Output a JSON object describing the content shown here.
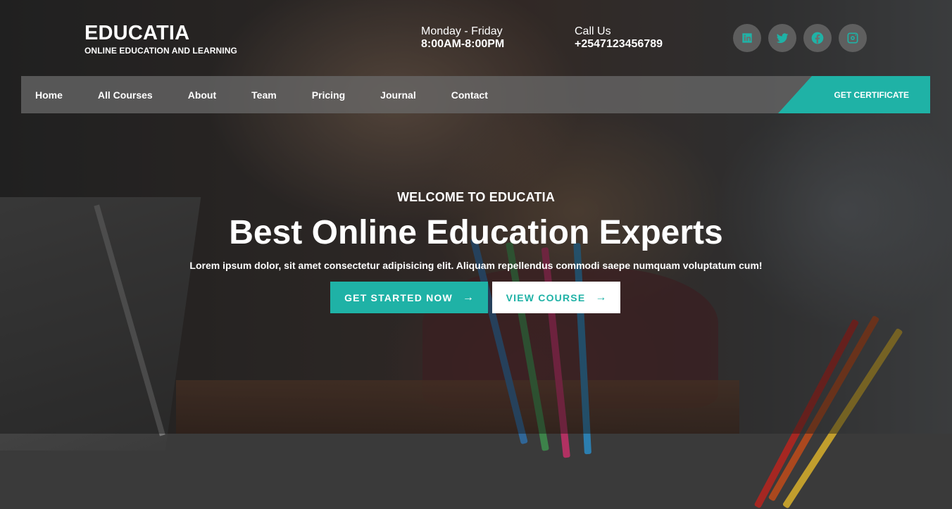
{
  "brand": {
    "name": "EDUCATIA",
    "tagline": "ONLINE EDUCATION AND LEARNING"
  },
  "contact": {
    "hours_label": "Monday - Friday",
    "hours_value": "8:00AM-8:00PM",
    "phone_label": "Call Us",
    "phone_value": "+2547123456789"
  },
  "socials": [
    {
      "icon": "linkedin-icon"
    },
    {
      "icon": "twitter-icon"
    },
    {
      "icon": "facebook-icon"
    },
    {
      "icon": "instagram-icon"
    }
  ],
  "nav": {
    "items": [
      {
        "label": "Home"
      },
      {
        "label": "All Courses"
      },
      {
        "label": "About"
      },
      {
        "label": "Team"
      },
      {
        "label": "Pricing"
      },
      {
        "label": "Journal"
      },
      {
        "label": "Contact"
      }
    ],
    "cta_label": "GET CERTIFICATE"
  },
  "hero": {
    "kicker": "WELCOME TO EDUCATIA",
    "title": "Best Online Education Experts",
    "lead": "Lorem ipsum dolor, sit amet consectetur adipisicing elit. Aliquam repellendus commodi saepe numquam voluptatum cum!",
    "primary_button": "GET STARTED NOW",
    "secondary_button": "VIEW COURSE",
    "arrow": "→"
  },
  "colors": {
    "accent": "#1fb2a6",
    "nav_bg": "#6a6a6a",
    "social_bg": "#6e6e6e"
  }
}
